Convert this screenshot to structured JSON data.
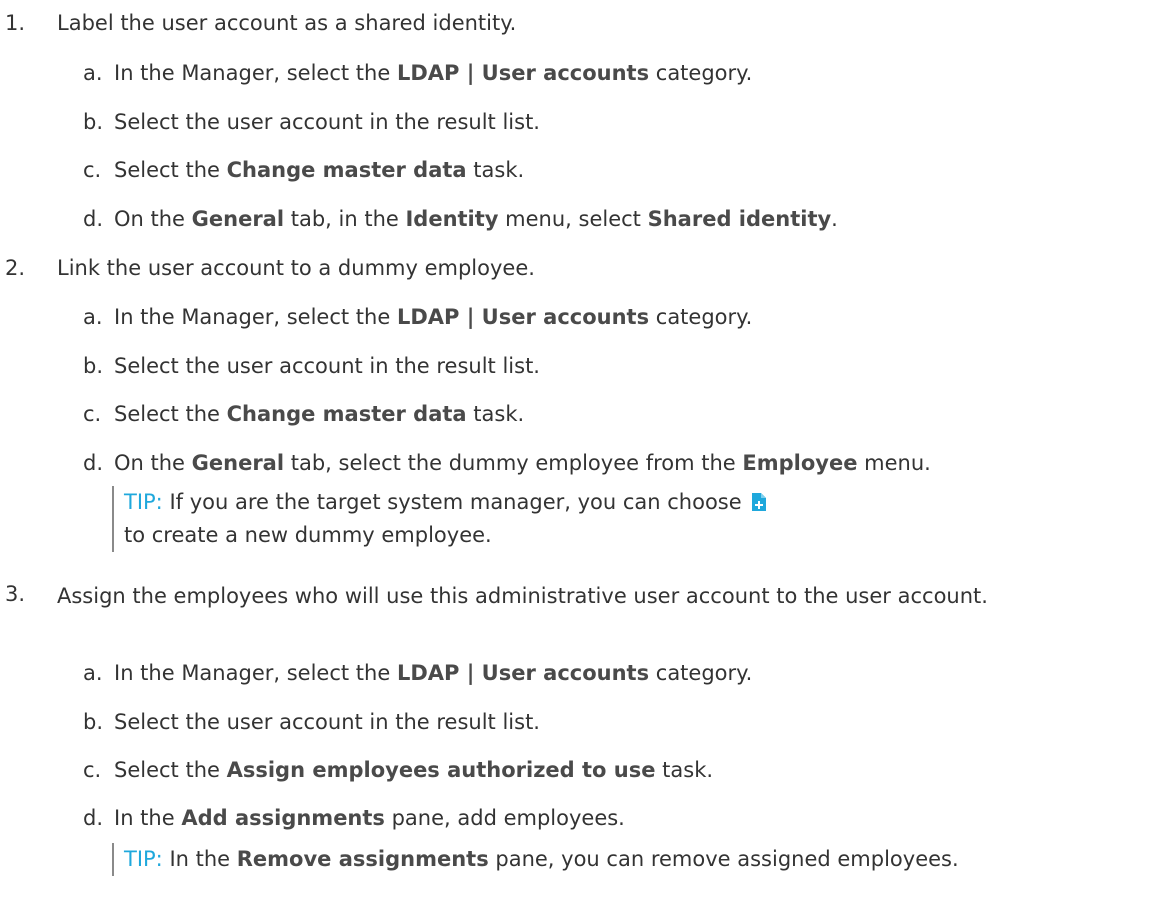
{
  "steps": [
    {
      "num": "1.",
      "text": "Label the user account as a shared identity.",
      "subs": [
        {
          "letter": "a.",
          "t1": "In the Manager, select the ",
          "b1": "LDAP | User accounts",
          "t2": " category."
        },
        {
          "letter": "b.",
          "t1": "Select the user account in the result list."
        },
        {
          "letter": "c.",
          "t1": "Select the ",
          "b1": "Change master data",
          "t2": " task."
        },
        {
          "letter": "d.",
          "t1": "On the ",
          "b1": "General",
          "t2": " tab, in the ",
          "b2": "Identity",
          "t3": " menu, select ",
          "b3": "Shared identity",
          "t4": "."
        }
      ]
    },
    {
      "num": "2.",
      "text": "Link the user account to a dummy employee.",
      "subs": [
        {
          "letter": "a.",
          "t1": "In the Manager, select the ",
          "b1": "LDAP | User accounts",
          "t2": " category."
        },
        {
          "letter": "b.",
          "t1": "Select the user account in the result list."
        },
        {
          "letter": "c.",
          "t1": "Select the ",
          "b1": "Change master data",
          "t2": " task."
        },
        {
          "letter": "d.",
          "t1": "On the ",
          "b1": "General",
          "t2": " tab, select the dummy employee from the ",
          "b2": "Employee",
          "t3": " menu."
        }
      ],
      "tip": {
        "label": "TIP:",
        "t1": " If you are the target system manager, you can choose ",
        "icon": "add-document-icon",
        "t2": " to create a new dummy employee."
      }
    },
    {
      "num": "3.",
      "text": "Assign the employees who will use this administrative user account to the user account.",
      "subs": [
        {
          "letter": "a.",
          "t1": "In the Manager, select the ",
          "b1": "LDAP | User accounts",
          "t2": " category."
        },
        {
          "letter": "b.",
          "t1": "Select the user account in the result list."
        },
        {
          "letter": "c.",
          "t1": "Select the ",
          "b1": "Assign employees authorized to use",
          "t2": " task."
        },
        {
          "letter": "d.",
          "t1": "In the ",
          "b1": "Add assignments",
          "t2": " pane, add employees."
        }
      ],
      "tip": {
        "label": "TIP:",
        "t1": " In the ",
        "b1": "Remove assignments",
        "t2": " pane, you can remove assigned employees."
      }
    }
  ],
  "colors": {
    "text": "#333333",
    "bold": "#4a4a4a",
    "tip_label": "#1fa8dc",
    "tip_bar": "#8a8a8a",
    "icon_fill": "#1fa8dc"
  }
}
